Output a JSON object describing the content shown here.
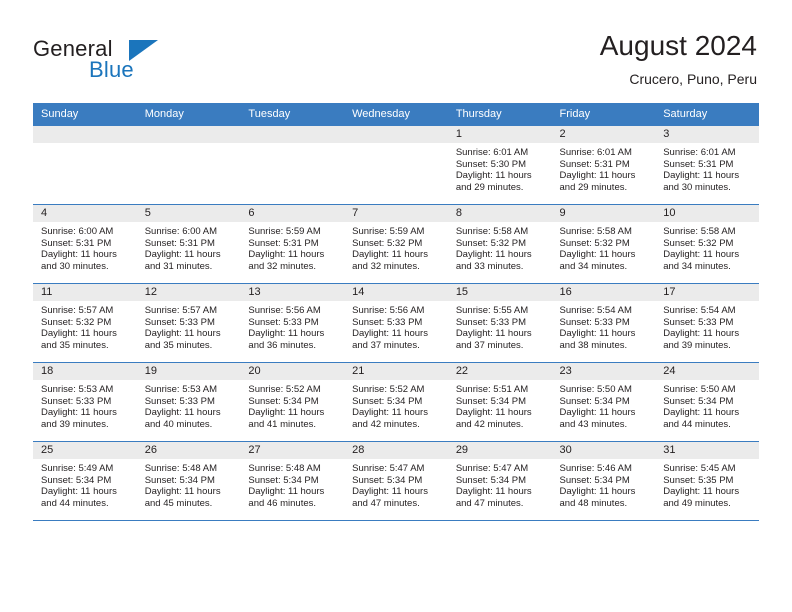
{
  "brand": {
    "name_part1": "General",
    "name_part2": "Blue",
    "accent_color": "#1b75bc"
  },
  "header": {
    "title": "August 2024",
    "subtitle": "Crucero, Puno, Peru"
  },
  "theme": {
    "header_row_color": "#3a7cc0",
    "daynum_band_color": "#ebebeb",
    "text_color": "#231f20"
  },
  "weekday_headers": [
    "Sunday",
    "Monday",
    "Tuesday",
    "Wednesday",
    "Thursday",
    "Friday",
    "Saturday"
  ],
  "weeks": [
    [
      {
        "day": "",
        "lines": []
      },
      {
        "day": "",
        "lines": []
      },
      {
        "day": "",
        "lines": []
      },
      {
        "day": "",
        "lines": []
      },
      {
        "day": "1",
        "lines": [
          "Sunrise: 6:01 AM",
          "Sunset: 5:30 PM",
          "Daylight: 11 hours",
          "and 29 minutes."
        ]
      },
      {
        "day": "2",
        "lines": [
          "Sunrise: 6:01 AM",
          "Sunset: 5:31 PM",
          "Daylight: 11 hours",
          "and 29 minutes."
        ]
      },
      {
        "day": "3",
        "lines": [
          "Sunrise: 6:01 AM",
          "Sunset: 5:31 PM",
          "Daylight: 11 hours",
          "and 30 minutes."
        ]
      }
    ],
    [
      {
        "day": "4",
        "lines": [
          "Sunrise: 6:00 AM",
          "Sunset: 5:31 PM",
          "Daylight: 11 hours",
          "and 30 minutes."
        ]
      },
      {
        "day": "5",
        "lines": [
          "Sunrise: 6:00 AM",
          "Sunset: 5:31 PM",
          "Daylight: 11 hours",
          "and 31 minutes."
        ]
      },
      {
        "day": "6",
        "lines": [
          "Sunrise: 5:59 AM",
          "Sunset: 5:31 PM",
          "Daylight: 11 hours",
          "and 32 minutes."
        ]
      },
      {
        "day": "7",
        "lines": [
          "Sunrise: 5:59 AM",
          "Sunset: 5:32 PM",
          "Daylight: 11 hours",
          "and 32 minutes."
        ]
      },
      {
        "day": "8",
        "lines": [
          "Sunrise: 5:58 AM",
          "Sunset: 5:32 PM",
          "Daylight: 11 hours",
          "and 33 minutes."
        ]
      },
      {
        "day": "9",
        "lines": [
          "Sunrise: 5:58 AM",
          "Sunset: 5:32 PM",
          "Daylight: 11 hours",
          "and 34 minutes."
        ]
      },
      {
        "day": "10",
        "lines": [
          "Sunrise: 5:58 AM",
          "Sunset: 5:32 PM",
          "Daylight: 11 hours",
          "and 34 minutes."
        ]
      }
    ],
    [
      {
        "day": "11",
        "lines": [
          "Sunrise: 5:57 AM",
          "Sunset: 5:32 PM",
          "Daylight: 11 hours",
          "and 35 minutes."
        ]
      },
      {
        "day": "12",
        "lines": [
          "Sunrise: 5:57 AM",
          "Sunset: 5:33 PM",
          "Daylight: 11 hours",
          "and 35 minutes."
        ]
      },
      {
        "day": "13",
        "lines": [
          "Sunrise: 5:56 AM",
          "Sunset: 5:33 PM",
          "Daylight: 11 hours",
          "and 36 minutes."
        ]
      },
      {
        "day": "14",
        "lines": [
          "Sunrise: 5:56 AM",
          "Sunset: 5:33 PM",
          "Daylight: 11 hours",
          "and 37 minutes."
        ]
      },
      {
        "day": "15",
        "lines": [
          "Sunrise: 5:55 AM",
          "Sunset: 5:33 PM",
          "Daylight: 11 hours",
          "and 37 minutes."
        ]
      },
      {
        "day": "16",
        "lines": [
          "Sunrise: 5:54 AM",
          "Sunset: 5:33 PM",
          "Daylight: 11 hours",
          "and 38 minutes."
        ]
      },
      {
        "day": "17",
        "lines": [
          "Sunrise: 5:54 AM",
          "Sunset: 5:33 PM",
          "Daylight: 11 hours",
          "and 39 minutes."
        ]
      }
    ],
    [
      {
        "day": "18",
        "lines": [
          "Sunrise: 5:53 AM",
          "Sunset: 5:33 PM",
          "Daylight: 11 hours",
          "and 39 minutes."
        ]
      },
      {
        "day": "19",
        "lines": [
          "Sunrise: 5:53 AM",
          "Sunset: 5:33 PM",
          "Daylight: 11 hours",
          "and 40 minutes."
        ]
      },
      {
        "day": "20",
        "lines": [
          "Sunrise: 5:52 AM",
          "Sunset: 5:34 PM",
          "Daylight: 11 hours",
          "and 41 minutes."
        ]
      },
      {
        "day": "21",
        "lines": [
          "Sunrise: 5:52 AM",
          "Sunset: 5:34 PM",
          "Daylight: 11 hours",
          "and 42 minutes."
        ]
      },
      {
        "day": "22",
        "lines": [
          "Sunrise: 5:51 AM",
          "Sunset: 5:34 PM",
          "Daylight: 11 hours",
          "and 42 minutes."
        ]
      },
      {
        "day": "23",
        "lines": [
          "Sunrise: 5:50 AM",
          "Sunset: 5:34 PM",
          "Daylight: 11 hours",
          "and 43 minutes."
        ]
      },
      {
        "day": "24",
        "lines": [
          "Sunrise: 5:50 AM",
          "Sunset: 5:34 PM",
          "Daylight: 11 hours",
          "and 44 minutes."
        ]
      }
    ],
    [
      {
        "day": "25",
        "lines": [
          "Sunrise: 5:49 AM",
          "Sunset: 5:34 PM",
          "Daylight: 11 hours",
          "and 44 minutes."
        ]
      },
      {
        "day": "26",
        "lines": [
          "Sunrise: 5:48 AM",
          "Sunset: 5:34 PM",
          "Daylight: 11 hours",
          "and 45 minutes."
        ]
      },
      {
        "day": "27",
        "lines": [
          "Sunrise: 5:48 AM",
          "Sunset: 5:34 PM",
          "Daylight: 11 hours",
          "and 46 minutes."
        ]
      },
      {
        "day": "28",
        "lines": [
          "Sunrise: 5:47 AM",
          "Sunset: 5:34 PM",
          "Daylight: 11 hours",
          "and 47 minutes."
        ]
      },
      {
        "day": "29",
        "lines": [
          "Sunrise: 5:47 AM",
          "Sunset: 5:34 PM",
          "Daylight: 11 hours",
          "and 47 minutes."
        ]
      },
      {
        "day": "30",
        "lines": [
          "Sunrise: 5:46 AM",
          "Sunset: 5:34 PM",
          "Daylight: 11 hours",
          "and 48 minutes."
        ]
      },
      {
        "day": "31",
        "lines": [
          "Sunrise: 5:45 AM",
          "Sunset: 5:35 PM",
          "Daylight: 11 hours",
          "and 49 minutes."
        ]
      }
    ]
  ]
}
